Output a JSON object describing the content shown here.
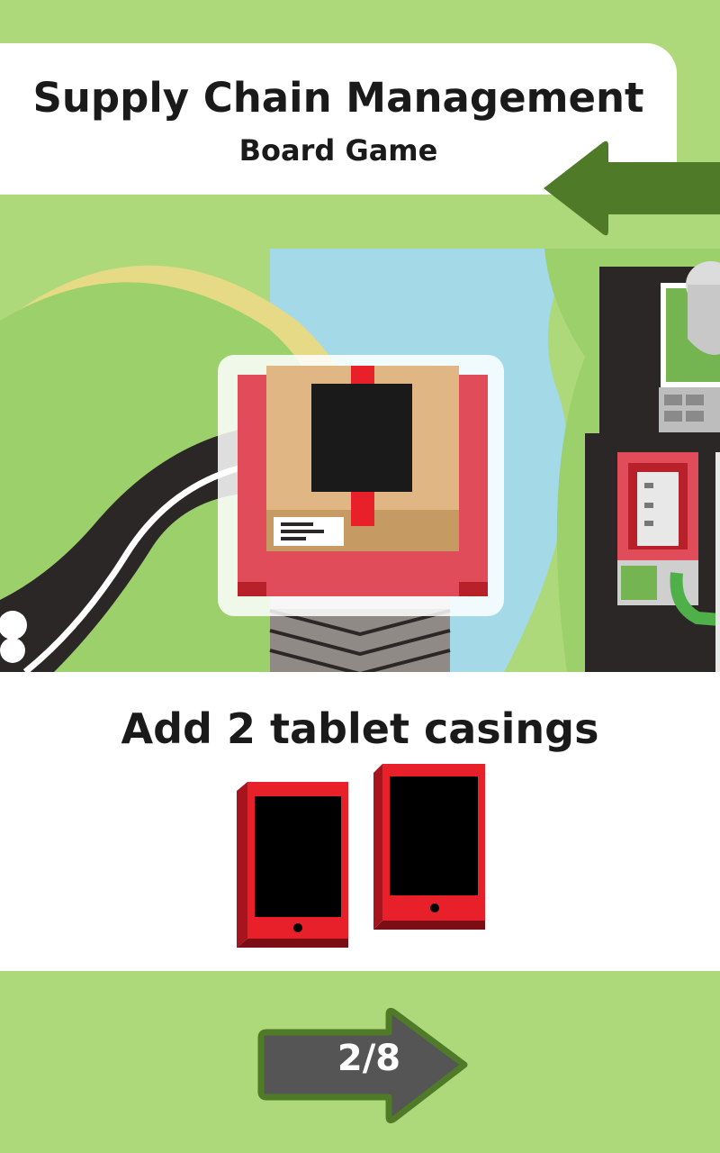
{
  "header": {
    "title": "Supply Chain Management",
    "subtitle": "Board Game"
  },
  "card": {
    "instruction": "Add 2 tablet casings",
    "item_icon": "tablet-casing-icon",
    "item_count": 2
  },
  "navigation": {
    "back_icon": "back-arrow-icon",
    "next_icon": "next-arrow-icon",
    "page_indicator": "2/8"
  },
  "colors": {
    "background": "#aed97a",
    "arrow_green": "#4f7a27",
    "next_button": "#555555",
    "tablet_red": "#e8202a",
    "box_tan": "#e0b784",
    "machine_red": "#e04c5a",
    "sky_blue": "#a4d9e8"
  }
}
